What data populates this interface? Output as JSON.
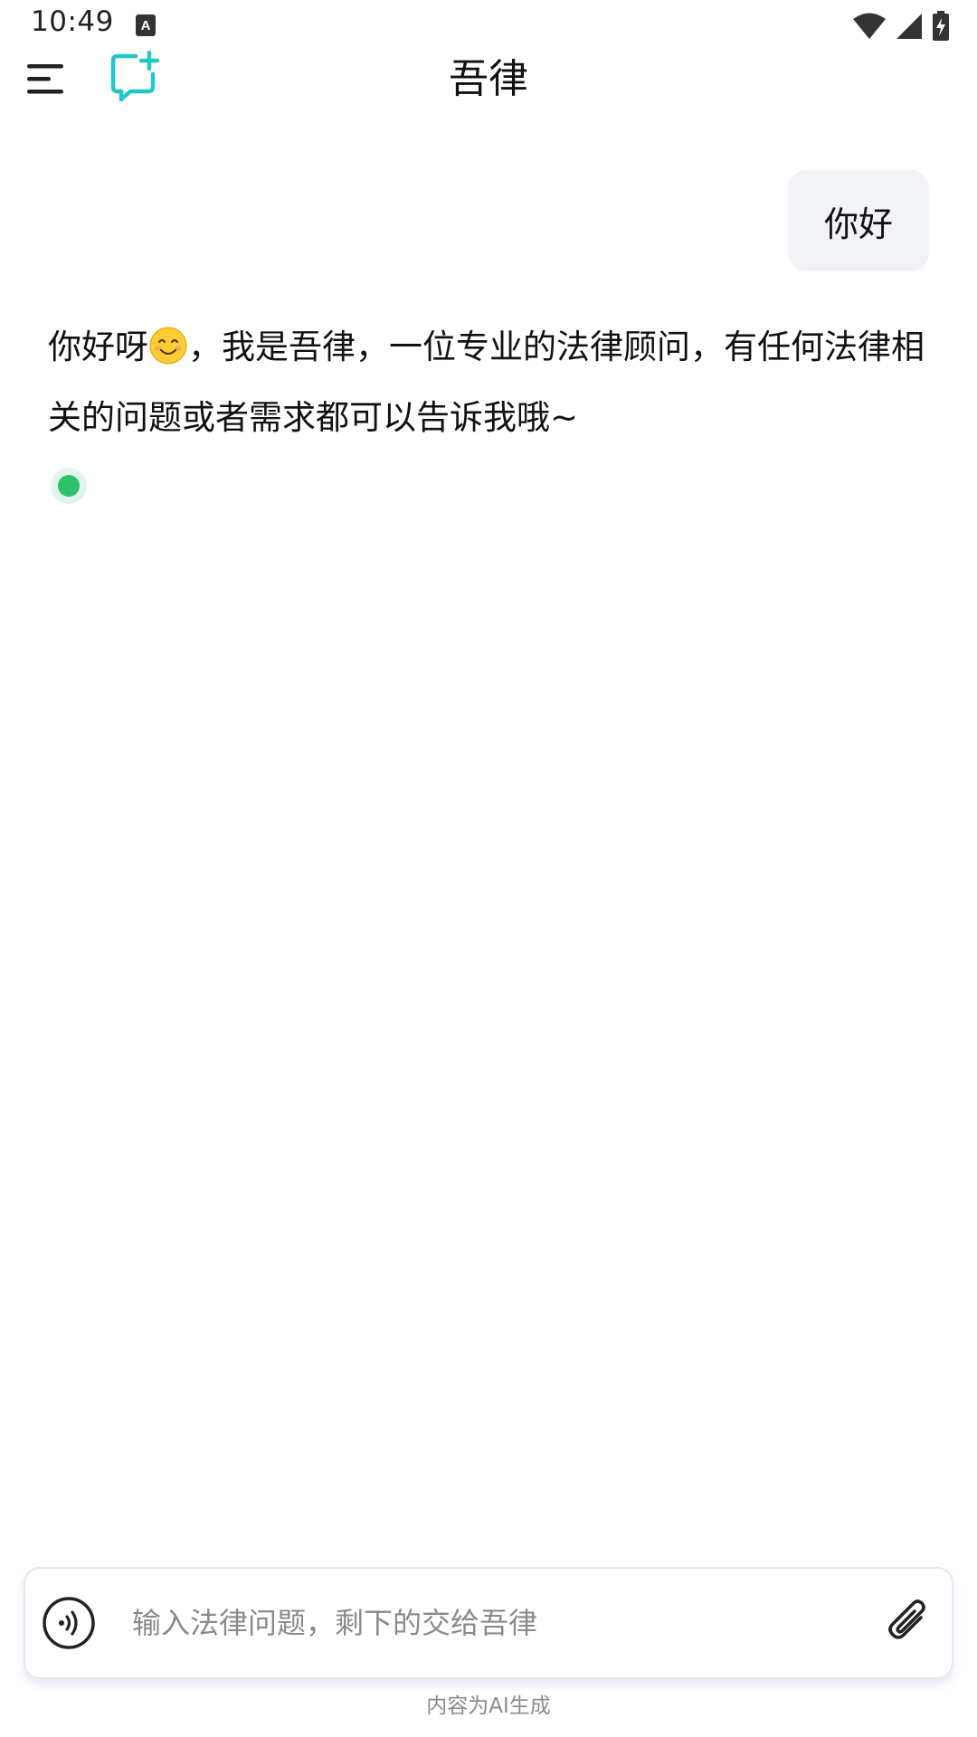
{
  "status_bar": {
    "time": "10:49",
    "icons": [
      "accessibility-a-icon",
      "wifi-icon",
      "cell-signal-icon",
      "battery-charging-icon"
    ]
  },
  "header": {
    "title": "吾律",
    "left_icons": [
      "menu-icon",
      "new-chat-icon"
    ]
  },
  "colors": {
    "accent": "#20c8c8",
    "user_bubble_bg": "#f2f3f6",
    "typing_dot": "#2ec16c"
  },
  "chat": {
    "user_message": "你好",
    "assistant_message_part1": "你好呀",
    "assistant_emoji": "smiling-face-emoji",
    "assistant_message_part2": "，我是吾律，一位专业的法律顾问，有任何法律相关的问题或者需求都可以告诉我哦~"
  },
  "composer": {
    "placeholder": "输入法律问题，剩下的交给吾律",
    "value": "",
    "voice_icon": "voice-input-icon",
    "attach_icon": "paperclip-icon"
  },
  "footer": {
    "note": "内容为AI生成"
  }
}
